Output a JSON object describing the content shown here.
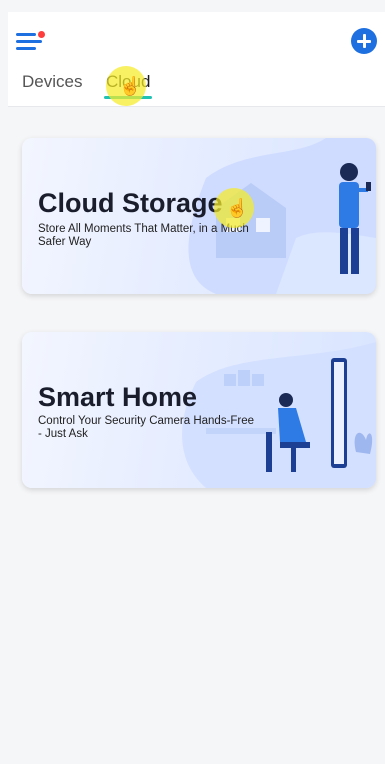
{
  "header": {
    "tabs": [
      {
        "label": "Devices"
      },
      {
        "label": "Cloud"
      }
    ]
  },
  "cards": [
    {
      "title": "Cloud Storage",
      "subtitle": "Store All Moments That Matter, in a Much Safer Way"
    },
    {
      "title": "Smart Home",
      "subtitle": "Control Your Security Camera Hands-Free - Just Ask"
    }
  ],
  "colors": {
    "accent": "#1e6fe0",
    "tab_indicator": "#20c2b4",
    "notification_dot": "#ff3d3d"
  }
}
